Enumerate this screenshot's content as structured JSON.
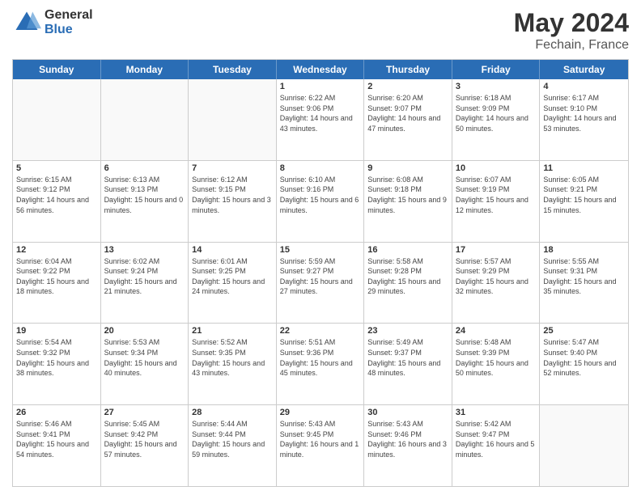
{
  "header": {
    "logo_line1": "General",
    "logo_line2": "Blue",
    "main_title": "May 2024",
    "subtitle": "Fechain, France"
  },
  "calendar": {
    "days_of_week": [
      "Sunday",
      "Monday",
      "Tuesday",
      "Wednesday",
      "Thursday",
      "Friday",
      "Saturday"
    ],
    "weeks": [
      [
        {
          "day": "",
          "empty": true
        },
        {
          "day": "",
          "empty": true
        },
        {
          "day": "",
          "empty": true
        },
        {
          "day": "1",
          "sunrise": "6:22 AM",
          "sunset": "9:06 PM",
          "daylight": "14 hours and 43 minutes."
        },
        {
          "day": "2",
          "sunrise": "6:20 AM",
          "sunset": "9:07 PM",
          "daylight": "14 hours and 47 minutes."
        },
        {
          "day": "3",
          "sunrise": "6:18 AM",
          "sunset": "9:09 PM",
          "daylight": "14 hours and 50 minutes."
        },
        {
          "day": "4",
          "sunrise": "6:17 AM",
          "sunset": "9:10 PM",
          "daylight": "14 hours and 53 minutes."
        }
      ],
      [
        {
          "day": "5",
          "sunrise": "6:15 AM",
          "sunset": "9:12 PM",
          "daylight": "14 hours and 56 minutes."
        },
        {
          "day": "6",
          "sunrise": "6:13 AM",
          "sunset": "9:13 PM",
          "daylight": "15 hours and 0 minutes."
        },
        {
          "day": "7",
          "sunrise": "6:12 AM",
          "sunset": "9:15 PM",
          "daylight": "15 hours and 3 minutes."
        },
        {
          "day": "8",
          "sunrise": "6:10 AM",
          "sunset": "9:16 PM",
          "daylight": "15 hours and 6 minutes."
        },
        {
          "day": "9",
          "sunrise": "6:08 AM",
          "sunset": "9:18 PM",
          "daylight": "15 hours and 9 minutes."
        },
        {
          "day": "10",
          "sunrise": "6:07 AM",
          "sunset": "9:19 PM",
          "daylight": "15 hours and 12 minutes."
        },
        {
          "day": "11",
          "sunrise": "6:05 AM",
          "sunset": "9:21 PM",
          "daylight": "15 hours and 15 minutes."
        }
      ],
      [
        {
          "day": "12",
          "sunrise": "6:04 AM",
          "sunset": "9:22 PM",
          "daylight": "15 hours and 18 minutes."
        },
        {
          "day": "13",
          "sunrise": "6:02 AM",
          "sunset": "9:24 PM",
          "daylight": "15 hours and 21 minutes."
        },
        {
          "day": "14",
          "sunrise": "6:01 AM",
          "sunset": "9:25 PM",
          "daylight": "15 hours and 24 minutes."
        },
        {
          "day": "15",
          "sunrise": "5:59 AM",
          "sunset": "9:27 PM",
          "daylight": "15 hours and 27 minutes."
        },
        {
          "day": "16",
          "sunrise": "5:58 AM",
          "sunset": "9:28 PM",
          "daylight": "15 hours and 29 minutes."
        },
        {
          "day": "17",
          "sunrise": "5:57 AM",
          "sunset": "9:29 PM",
          "daylight": "15 hours and 32 minutes."
        },
        {
          "day": "18",
          "sunrise": "5:55 AM",
          "sunset": "9:31 PM",
          "daylight": "15 hours and 35 minutes."
        }
      ],
      [
        {
          "day": "19",
          "sunrise": "5:54 AM",
          "sunset": "9:32 PM",
          "daylight": "15 hours and 38 minutes."
        },
        {
          "day": "20",
          "sunrise": "5:53 AM",
          "sunset": "9:34 PM",
          "daylight": "15 hours and 40 minutes."
        },
        {
          "day": "21",
          "sunrise": "5:52 AM",
          "sunset": "9:35 PM",
          "daylight": "15 hours and 43 minutes."
        },
        {
          "day": "22",
          "sunrise": "5:51 AM",
          "sunset": "9:36 PM",
          "daylight": "15 hours and 45 minutes."
        },
        {
          "day": "23",
          "sunrise": "5:49 AM",
          "sunset": "9:37 PM",
          "daylight": "15 hours and 48 minutes."
        },
        {
          "day": "24",
          "sunrise": "5:48 AM",
          "sunset": "9:39 PM",
          "daylight": "15 hours and 50 minutes."
        },
        {
          "day": "25",
          "sunrise": "5:47 AM",
          "sunset": "9:40 PM",
          "daylight": "15 hours and 52 minutes."
        }
      ],
      [
        {
          "day": "26",
          "sunrise": "5:46 AM",
          "sunset": "9:41 PM",
          "daylight": "15 hours and 54 minutes."
        },
        {
          "day": "27",
          "sunrise": "5:45 AM",
          "sunset": "9:42 PM",
          "daylight": "15 hours and 57 minutes."
        },
        {
          "day": "28",
          "sunrise": "5:44 AM",
          "sunset": "9:44 PM",
          "daylight": "15 hours and 59 minutes."
        },
        {
          "day": "29",
          "sunrise": "5:43 AM",
          "sunset": "9:45 PM",
          "daylight": "16 hours and 1 minute."
        },
        {
          "day": "30",
          "sunrise": "5:43 AM",
          "sunset": "9:46 PM",
          "daylight": "16 hours and 3 minutes."
        },
        {
          "day": "31",
          "sunrise": "5:42 AM",
          "sunset": "9:47 PM",
          "daylight": "16 hours and 5 minutes."
        },
        {
          "day": "",
          "empty": true
        }
      ]
    ]
  }
}
